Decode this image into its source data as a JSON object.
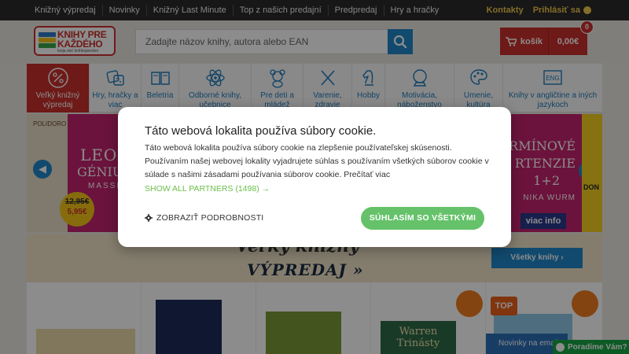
{
  "topnav": {
    "items": [
      "Knižný výpredaj",
      "Novinky",
      "Knižný Last Minute",
      "Top z našich predajní",
      "Predpredaj",
      "Hry a hračky"
    ],
    "contacts": "Kontakty",
    "login": "Prihlásiť sa"
  },
  "header": {
    "logo_line1": "KNIHY PRE",
    "logo_line2": "KAŽDÉHO",
    "logo_sub": "tvoja sieť kníhkupectiev",
    "search_placeholder": "Zadajte názov knihy, autora alebo EAN",
    "cart_label": "košík",
    "cart_total": "0,00€",
    "cart_count": "0"
  },
  "categories": [
    {
      "label": "Veľký knižný výpredaj",
      "icon": "percent-icon"
    },
    {
      "label": "Hry, hračky a viac",
      "icon": "dice-icon"
    },
    {
      "label": "Beletria",
      "icon": "open-book-icon"
    },
    {
      "label": "Odborné knihy, učebnice",
      "icon": "atom-icon"
    },
    {
      "label": "Pre deti a mládež",
      "icon": "teddy-bear-icon"
    },
    {
      "label": "Varenie, zdravie",
      "icon": "fork-knife-icon"
    },
    {
      "label": "Hobby",
      "icon": "chess-knight-icon"
    },
    {
      "label": "Motivácia, náboženstvo",
      "icon": "crystal-ball-icon"
    },
    {
      "label": "Umenie, kultúra",
      "icon": "palette-icon"
    },
    {
      "label": "Knihy v angličtine a iných jazykoch",
      "icon": "eng-icon"
    }
  ],
  "banner": {
    "left_author": "POLIDORO",
    "left_title1": "LEON",
    "left_title2": "GÉNIUS",
    "left_title3": "MASSIM",
    "old_price": "12,95€",
    "new_price": "5,95€",
    "right_title1": "RMÍNOVÉ",
    "right_title2": "RTENZIE",
    "right_title3": "1+2",
    "right_author": "NIKA WURM",
    "right_info": "viac info",
    "right_book": "DON"
  },
  "promo": {
    "line1": "Veľký knižný",
    "line2": "VÝPREDAJ »",
    "all_books": "Všetky knihy ›"
  },
  "products": {
    "top_label": "TOP",
    "book3_title": "Warren Trinásty"
  },
  "newsletter": "Novinky na email",
  "chat": "Poradíme Vám?",
  "cookie": {
    "title": "Táto webová lokalita používa súbory cookie.",
    "text": "Táto webová lokalita používa súbory cookie na zlepšenie používateľskej skúsenosti. Používaním našej webovej lokality vyjadrujete súhlas s používaním všetkých súborov cookie v súlade s našimi zásadami používania súborov cookie. Prečítať viac",
    "partners": "SHOW ALL PARTNERS (1498) →",
    "details": "ZOBRAZIŤ PODROBNOSTI",
    "accept": "SÚHLASÍM SO VŠETKÝMI"
  },
  "colors": {
    "brand_red": "#c9302c",
    "accent_blue": "#1f87c8",
    "accept_green": "#65c26a"
  }
}
